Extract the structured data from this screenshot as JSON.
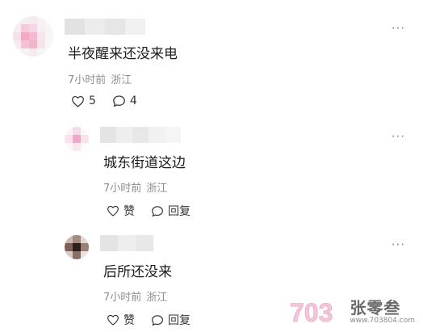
{
  "comments": [
    {
      "text": "半夜醒来还没来电",
      "time": "7小时前",
      "location": "浙江",
      "like_count": "5",
      "reply_count": "4",
      "more_label": "···"
    }
  ],
  "replies": [
    {
      "text": "城东街道这边",
      "time": "7小时前",
      "location": "浙江",
      "like_label": "赞",
      "reply_label": "回复",
      "more_label": "···"
    },
    {
      "text": "后所还没来",
      "time": "7小时前",
      "location": "浙江",
      "like_label": "赞",
      "reply_label": "回复",
      "more_label": "···"
    }
  ],
  "watermark": {
    "brand": "张零叁",
    "url": "www.703804.com",
    "logo_text": "703"
  },
  "icons": {
    "like": "heart-outline-icon",
    "comment": "speech-bubble-icon",
    "more": "ellipsis-icon"
  },
  "colors": {
    "text": "#1c1c1c",
    "meta": "#8f8f8f",
    "icon": "#333333"
  }
}
